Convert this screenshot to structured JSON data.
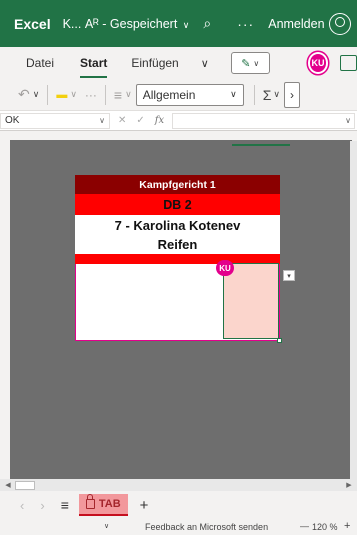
{
  "titlebar": {
    "app_name": "Excel",
    "document_title": "K... Αᴿ - Gespeichert",
    "document_chevron": "∨",
    "search_icon": "⌕",
    "more_icon": "···",
    "signin_label": "Anmelden"
  },
  "menubar": {
    "tabs": [
      "Datei",
      "Start",
      "Einfügen"
    ],
    "active_tab": "Start",
    "overflow_chevron": "∨",
    "pen_icon": "✎",
    "pen_chevron": "∨",
    "presence_initials": "KU"
  },
  "ribbon": {
    "undo_icon": "↶",
    "undo_chevron": "∨",
    "fill_icon": "▬",
    "fill_chevron": "∨",
    "more_icon": "···",
    "align_icon": "≡",
    "align_chevron": "∨",
    "number_format": "Allgemein",
    "format_chevron": "∨",
    "sum_icon": "Σ",
    "sum_chevron": "∨",
    "next_icon": "›"
  },
  "formula_bar": {
    "name_box": "OK",
    "name_chevron": "∨",
    "cancel_icon": "✕",
    "confirm_icon": "✓",
    "fx_label": "fx",
    "expand_icon": "∨"
  },
  "sheet_content": {
    "header": "Kampfgericht 1",
    "group": "DB 2",
    "athlete": "7 - Karolina Kotenev",
    "apparatus": "Reifen",
    "collaborator_flag": "KU",
    "dropdown_icon": "▾"
  },
  "hscroll": {
    "left_arrow": "◀",
    "right_arrow": "▶"
  },
  "sheetbar": {
    "prev_icon": "‹",
    "next_icon": "›",
    "menu_icon": "≡",
    "active_sheet": "TAB",
    "add_icon": "+"
  },
  "statusbar": {
    "chevron": "∨",
    "feedback": "Feedback an Microsoft senden",
    "minus": "—",
    "zoom": "120 %",
    "plus": "+"
  },
  "colors": {
    "excel_green": "#217346",
    "header_dark_red": "#8b0000",
    "header_red": "#ff0000",
    "presence_magenta": "#e3008c",
    "selected_fill": "#fbd5cc",
    "grid_background": "#6e6e6e",
    "sheet_tab_fill": "#f2989c"
  }
}
